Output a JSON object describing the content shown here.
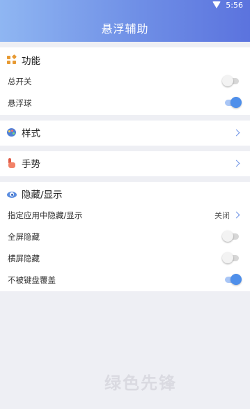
{
  "status_bar": {
    "time": "5:56",
    "wifi_icon": "wifi-icon"
  },
  "header": {
    "title": "悬浮辅助"
  },
  "function_section": {
    "title": "功能",
    "icon": "features-icon",
    "rows": [
      {
        "label": "总开关",
        "enabled": false
      },
      {
        "label": "悬浮球",
        "enabled": true
      }
    ]
  },
  "style_section": {
    "title": "样式",
    "icon": "palette-icon"
  },
  "gesture_section": {
    "title": "手势",
    "icon": "hand-icon"
  },
  "hide_section": {
    "title": "隐藏/显示",
    "icon": "eye-icon",
    "app_rule": {
      "label": "指定应用中隐藏/显示",
      "value": "关闭"
    },
    "rows": [
      {
        "label": "全屏隐藏",
        "enabled": false
      },
      {
        "label": "横屏隐藏",
        "enabled": false
      },
      {
        "label": "不被键盘覆盖",
        "enabled": true
      }
    ]
  },
  "colors": {
    "accent": "#4f8fea",
    "header_start": "#8fb6f2",
    "header_end": "#5b73de",
    "background": "#eeeff4"
  },
  "watermark": {
    "text": "绿色先锋",
    "sub": ""
  }
}
